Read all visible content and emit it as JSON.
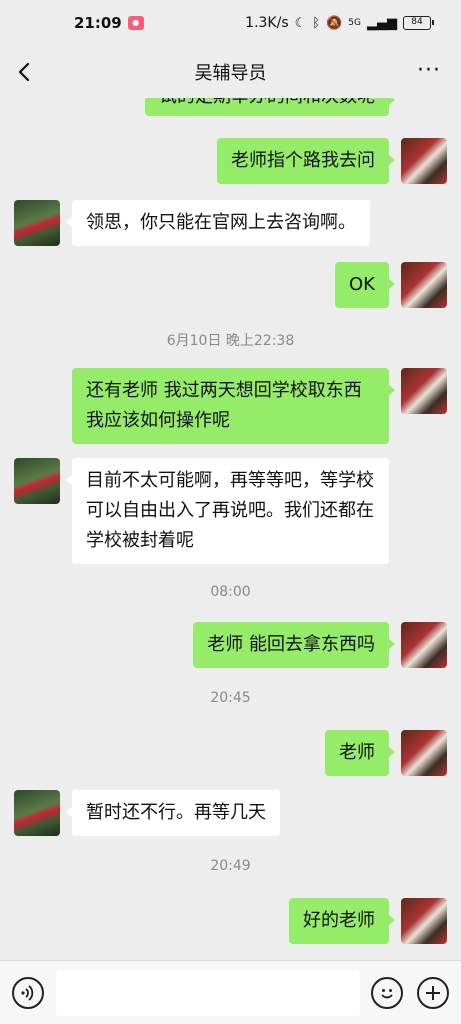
{
  "status_bar": {
    "time": "21:09",
    "speed": "1.3K/s",
    "network": "5G",
    "battery": "84"
  },
  "header": {
    "title": "吴辅导员"
  },
  "messages": [
    {
      "type": "me",
      "text": "试的定期举办的间和次数呢"
    },
    {
      "type": "me",
      "text": "老师指个路我去问"
    },
    {
      "type": "other",
      "text": "领思，你只能在官网上去咨询啊。"
    },
    {
      "type": "me",
      "text": "OK"
    },
    {
      "type": "time",
      "text": "6月10日 晚上22:38"
    },
    {
      "type": "me",
      "text": "还有老师 我过两天想回学校取东西我应该如何操作呢"
    },
    {
      "type": "other",
      "text": "目前不太可能啊，再等等吧，等学校可以自由出入了再说吧。我们还都在学校被封着呢"
    },
    {
      "type": "time",
      "text": "08:00"
    },
    {
      "type": "me",
      "text": "老师 能回去拿东西吗"
    },
    {
      "type": "time",
      "text": "20:45"
    },
    {
      "type": "me",
      "text": "老师"
    },
    {
      "type": "other",
      "text": "暂时还不行。再等几天"
    },
    {
      "type": "time",
      "text": "20:49"
    },
    {
      "type": "me",
      "text": "好的老师"
    }
  ],
  "input": {
    "value": ""
  }
}
